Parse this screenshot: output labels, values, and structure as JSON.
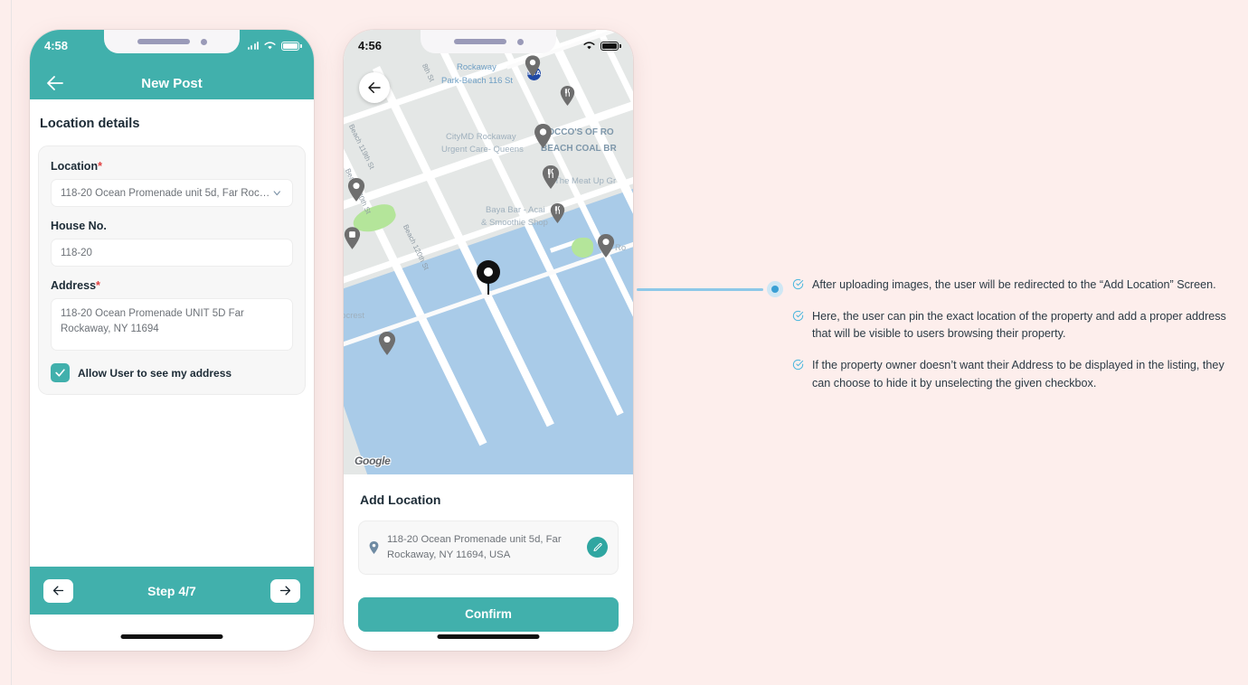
{
  "background_color": "#fdeeec",
  "accent_teal": "#41b0ac",
  "phone1": {
    "status": {
      "time": "4:58",
      "wifi_icon": "wifi-icon",
      "battery_icon": "battery-icon",
      "signal_icon": "signal-dots-icon"
    },
    "header": {
      "title": "New Post",
      "back_icon": "arrow-left-icon"
    },
    "section_title": "Location details",
    "fields": {
      "location": {
        "label": "Location",
        "required": "*",
        "value": "118-20 Ocean Promenade unit 5d, Far Rocka...",
        "chevron_icon": "chevron-down-icon"
      },
      "house_no": {
        "label": "House No.",
        "value": "118-20"
      },
      "address": {
        "label": "Address",
        "required": "*",
        "value": "118-20 Ocean Promenade UNIT 5D Far Rockaway, NY 11694"
      }
    },
    "checkbox": {
      "label": "Allow User to see my address",
      "checked": true,
      "icon": "check-icon"
    },
    "footer": {
      "step_label": "Step 4/7",
      "prev_icon": "arrow-left-icon",
      "next_icon": "arrow-right-icon"
    }
  },
  "phone2": {
    "status": {
      "time": "4:56",
      "wifi_icon": "wifi-icon",
      "battery_icon": "battery-icon",
      "signal_icon": "signal-dots-icon"
    },
    "map": {
      "back_icon": "arrow-left-icon",
      "watermark": "Google",
      "marker_icon": "map-pin-icon",
      "streets": [
        "Beach 119th St",
        "Beach 120th St",
        "8th St",
        "Beach 120th St"
      ],
      "labels": [
        "Rockaway",
        "Park-Beach 116 St",
        "CityMD Rockaway",
        "Urgent Care- Queens",
        "ROCCO'S OF RO",
        "BEACH COAL BR",
        "The Meat Up Gr",
        "Baya Bar - Acai",
        "& Smoothie Shop",
        "rocrest",
        "Ro"
      ]
    },
    "sheet": {
      "title": "Add Location",
      "address": "118-20 Ocean Promenade unit 5d, Far Rockaway, NY 11694, USA",
      "pin_icon": "location-pin-icon",
      "edit_icon": "pencil-icon",
      "confirm_label": "Confirm"
    }
  },
  "annotations": {
    "connector_color": "#8dc8e8",
    "items": [
      {
        "icon": "check-circle-icon",
        "text": "After uploading images, the user will be redirected to the “Add Location” Screen."
      },
      {
        "icon": "check-circle-icon",
        "text": "Here, the user can pin the exact location of the property and add a proper address that will be visible to users browsing their property."
      },
      {
        "icon": "check-circle-icon",
        "text": "If the property owner doesn’t want their Address to be displayed in the listing, they can choose to hide it by unselecting the given checkbox."
      }
    ]
  }
}
